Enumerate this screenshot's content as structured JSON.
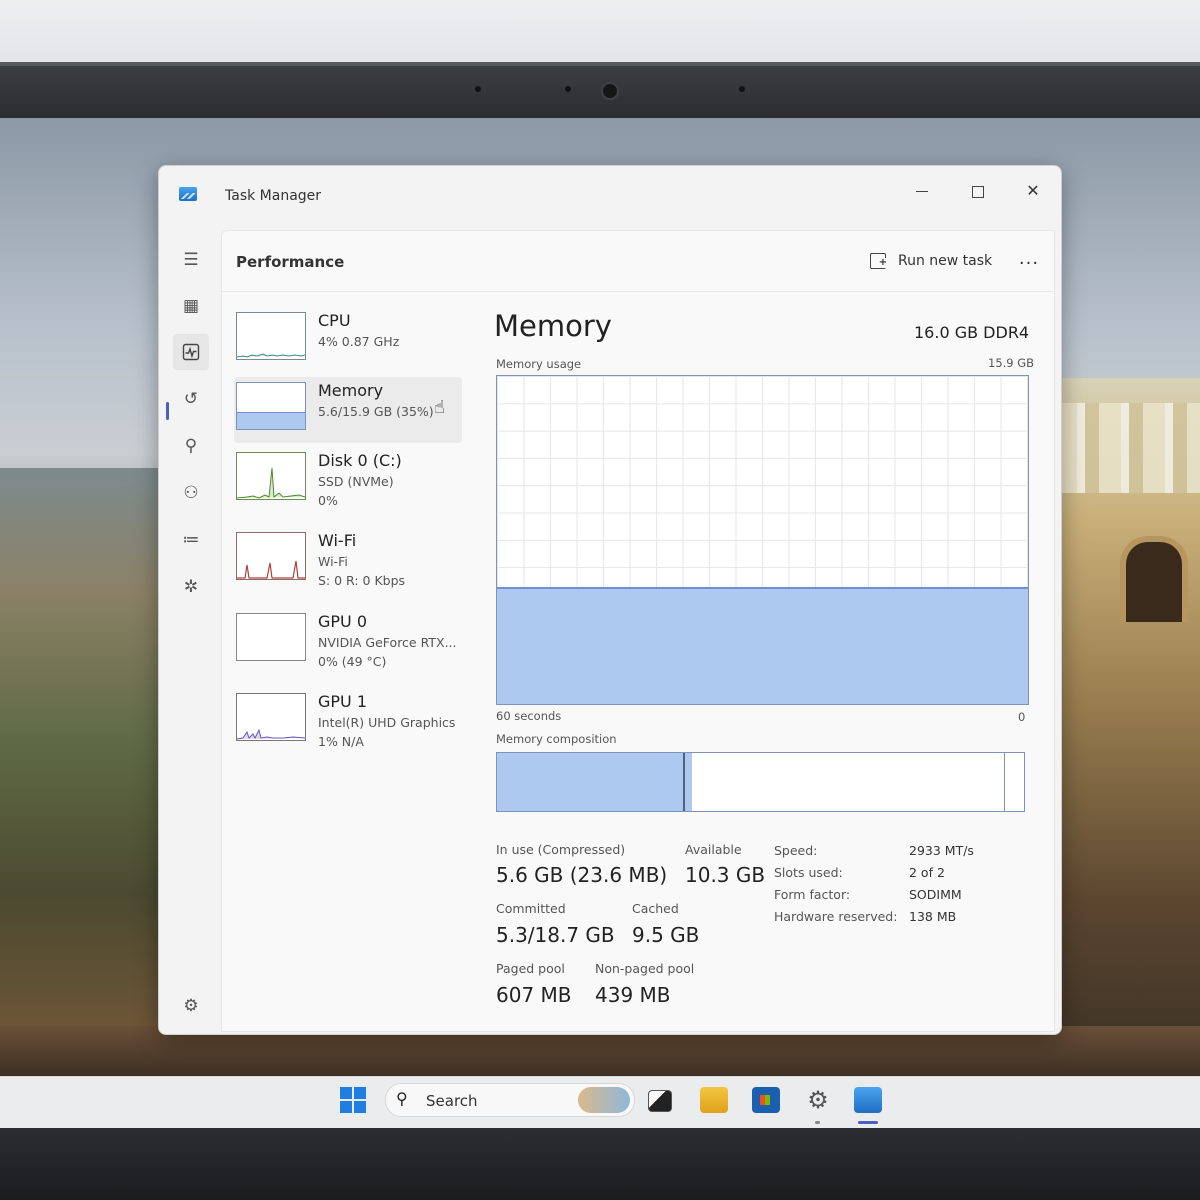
{
  "window": {
    "title": "Task Manager"
  },
  "header": {
    "page_title": "Performance",
    "run_new_task": "Run new task",
    "more_options": "..."
  },
  "devices": [
    {
      "name": "CPU",
      "line1": "4% 0.87 GHz",
      "line2": ""
    },
    {
      "name": "Memory",
      "line1": "5.6/15.9 GB (35%)",
      "line2": ""
    },
    {
      "name": "Disk 0 (C:)",
      "line1": "SSD (NVMe)",
      "line2": "0%"
    },
    {
      "name": "Wi-Fi",
      "line1": "Wi-Fi",
      "line2": "S: 0 R: 0 Kbps"
    },
    {
      "name": "GPU 0",
      "line1": "NVIDIA GeForce RTX...",
      "line2": "0% (49 °C)"
    },
    {
      "name": "GPU 1",
      "line1": "Intel(R) UHD Graphics",
      "line2": "1% N/A"
    }
  ],
  "memory": {
    "title": "Memory",
    "spec": "16.0 GB DDR4",
    "usage_label": "Memory usage",
    "usage_max": "15.9 GB",
    "axis_left": "60 seconds",
    "axis_right": "0",
    "usage_fraction": 0.35,
    "composition_label": "Memory composition",
    "composition": {
      "in_use_fraction": 0.352,
      "modified_fraction": 0.015,
      "standby_fraction": 0.595
    },
    "stats": {
      "in_use_label": "In use (Compressed)",
      "in_use_value": "5.6 GB (23.6 MB)",
      "available_label": "Available",
      "available_value": "10.3 GB",
      "committed_label": "Committed",
      "committed_value": "5.3/18.7 GB",
      "cached_label": "Cached",
      "cached_value": "9.5 GB",
      "paged_label": "Paged pool",
      "paged_value": "607 MB",
      "nonpaged_label": "Non-paged pool",
      "nonpaged_value": "439 MB"
    },
    "specs": [
      {
        "key": "Speed:",
        "value": "2933 MT/s"
      },
      {
        "key": "Slots used:",
        "value": "2 of 2"
      },
      {
        "key": "Form factor:",
        "value": "SODIMM"
      },
      {
        "key": "Hardware reserved:",
        "value": "138 MB"
      }
    ]
  },
  "taskbar": {
    "search_label": "Search"
  },
  "colors": {
    "graph_fill": "#adc9ef",
    "graph_border": "#7e93b8",
    "accent": "#4a5fc1"
  },
  "icons": {
    "nav": [
      "hamburger-icon",
      "processes-icon",
      "performance-icon",
      "app-history-icon",
      "startup-apps-icon",
      "users-icon",
      "details-icon",
      "services-icon",
      "settings-icon"
    ]
  }
}
